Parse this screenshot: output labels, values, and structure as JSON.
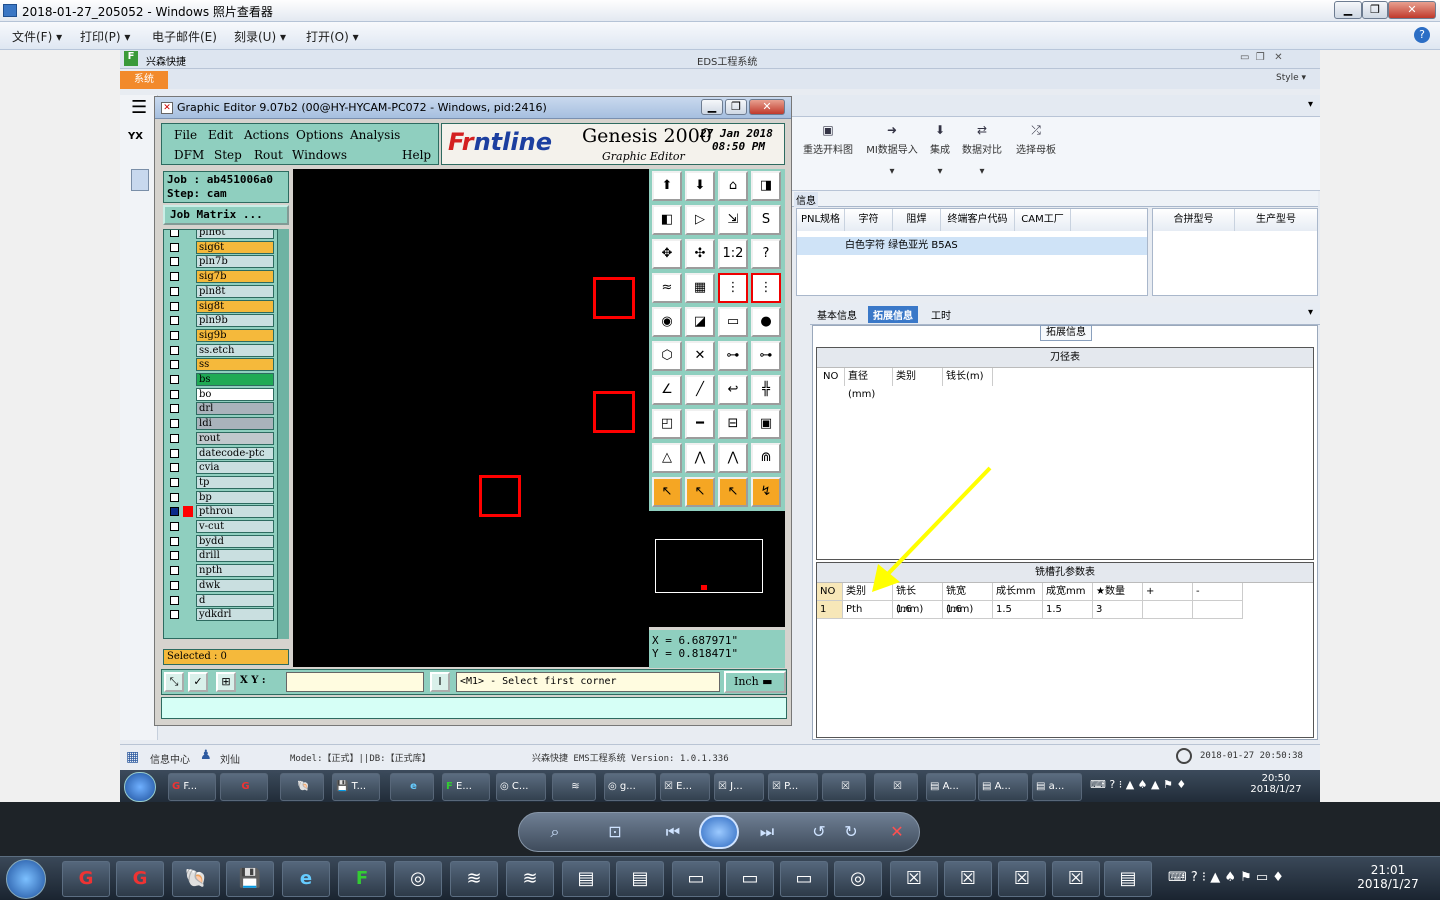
{
  "viewer": {
    "title": "2018-01-27_205052 - Windows 照片查看器",
    "menu": [
      "文件(F)",
      "打印(P)",
      "电子邮件(E)",
      "刻录(U)",
      "打开(O)"
    ]
  },
  "eds": {
    "app_title": "EDS工程系统",
    "brand": "兴森快捷",
    "tab_system": "系统",
    "style_label": "Style",
    "tools": [
      "重选开料图",
      "MI数据导入",
      "集成",
      "数据对比",
      "选择母板"
    ],
    "info_label": "信息",
    "grid1_headers": [
      "PNL规格",
      "字符",
      "阻焊",
      "终端客户代码",
      "CAM工厂"
    ],
    "grid1_row": "白色字符  绿色亚光  B5AS",
    "grid2_headers": [
      "合拼型号",
      "生产型号"
    ],
    "tabs": [
      "基本信息",
      "拓展信息",
      "工时"
    ],
    "ext_label": "拓展信息",
    "tool_table": {
      "title": "刀径表",
      "headers": [
        "NO",
        "直径(mm)",
        "类别",
        "钱长(m)"
      ]
    },
    "slot_table": {
      "title": "铣槽孔参数表",
      "headers": [
        "NO",
        "类别",
        "铣长(mm)",
        "铣宽(mm)",
        "成长mm",
        "成宽mm",
        "★数量",
        "+",
        "-"
      ],
      "row": [
        "1",
        "Pth",
        "1.6",
        "1.6",
        "1.5",
        "1.5",
        "3",
        "",
        ""
      ]
    },
    "status": {
      "info_center": "信息中心",
      "user": "刘仙",
      "model": "Model:【正式】||DB:【正式库】",
      "version": "兴森快捷  EMS工程系统  Version: 1.0.1.336",
      "datetime": "2018-01-27 20:50:38"
    },
    "taskbar": {
      "items": [
        "F...",
        "",
        "",
        "T...",
        "",
        "E...",
        "C...",
        "",
        "g...",
        "E...",
        "J...",
        "P...",
        "",
        "",
        "A...",
        "A...",
        "a..."
      ],
      "time": "20:50",
      "date": "2018/1/27"
    }
  },
  "editor": {
    "title": "Graphic Editor 9.07b2 (00@HY-HYCAM-PC072 - Windows, pid:2416)",
    "menu_row1": [
      "File",
      "Edit",
      "Actions",
      "Options",
      "Analysis"
    ],
    "menu_row2": [
      "DFM",
      "Step",
      "Rout",
      "Windows",
      "Help"
    ],
    "logo_front": "Fr",
    "logo_rest": "ntline",
    "product": "Genesis 2000",
    "subtitle": "Graphic Editor",
    "date_line1": "27 Jan 2018",
    "date_line2": "08:50 PM",
    "job": "Job : ab451006a0",
    "step": "Step: cam",
    "job_matrix": "Job Matrix ...",
    "layers": [
      {
        "name": "pln6t",
        "color": "#c9dfe0"
      },
      {
        "name": "sig6t",
        "color": "#f5b93b"
      },
      {
        "name": "pln7b",
        "color": "#c9dfe0"
      },
      {
        "name": "sig7b",
        "color": "#f5b93b"
      },
      {
        "name": "pln8t",
        "color": "#c9dfe0"
      },
      {
        "name": "sig8t",
        "color": "#f5b93b"
      },
      {
        "name": "pln9b",
        "color": "#c9dfe0"
      },
      {
        "name": "sig9b",
        "color": "#f5b93b"
      },
      {
        "name": "ss.etch",
        "color": "#c9dfe0"
      },
      {
        "name": "ss",
        "color": "#f5b93b"
      },
      {
        "name": "bs",
        "color": "#1faa55"
      },
      {
        "name": "bo",
        "color": "#ffffff"
      },
      {
        "name": "drl",
        "color": "#a9b3bb"
      },
      {
        "name": "ldi",
        "color": "#a9b3bb"
      },
      {
        "name": "rout",
        "color": "#c0c8cc"
      },
      {
        "name": "datecode-ptc",
        "color": "#c9dfe0"
      },
      {
        "name": "cvia",
        "color": "#c9dfe0"
      },
      {
        "name": "tp",
        "color": "#c9dfe0"
      },
      {
        "name": "bp",
        "color": "#c9dfe0"
      },
      {
        "name": "pthrou",
        "color": "#c9dfe0"
      },
      {
        "name": "v-cut",
        "color": "#c9dfe0"
      },
      {
        "name": "bydd",
        "color": "#c9dfe0"
      },
      {
        "name": "drill",
        "color": "#c9dfe0"
      },
      {
        "name": "npth",
        "color": "#c9dfe0"
      },
      {
        "name": "dwk",
        "color": "#c9dfe0"
      },
      {
        "name": "d",
        "color": "#c9dfe0"
      },
      {
        "name": "ydkdrl",
        "color": "#c9dfe0"
      }
    ],
    "selected": "Selected : 0",
    "coord_x": "X = 6.687971\"",
    "coord_y": "Y = 0.818471\"",
    "xy_label": "X Y :",
    "message": "<M1> - Select first corner",
    "unit": "Inch"
  },
  "pv_controls": {
    "time": "21:01",
    "date": "2018/1/27"
  }
}
